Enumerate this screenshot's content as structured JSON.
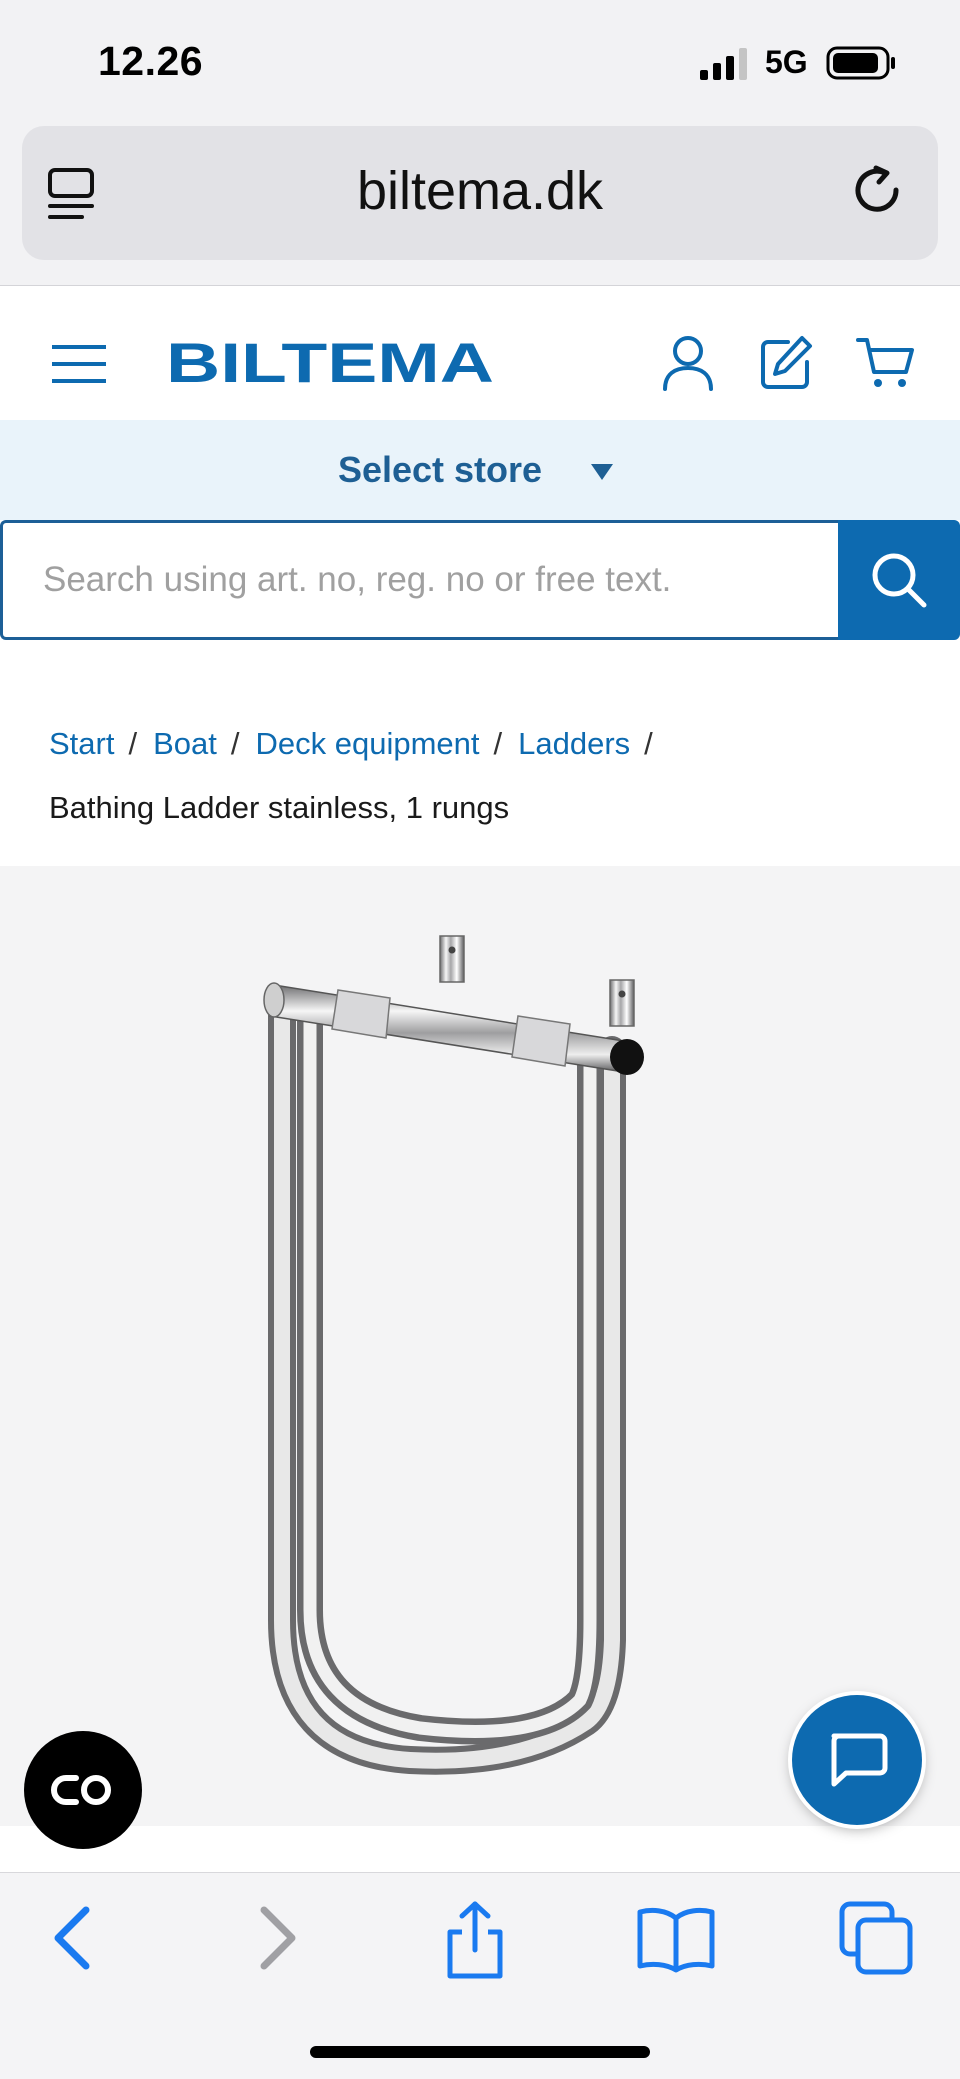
{
  "status_bar": {
    "time": "12.26",
    "network": "5G",
    "signal_icon": "signal-bars-icon",
    "battery_icon": "battery-icon"
  },
  "browser": {
    "url": "biltema.dk",
    "page_menu_icon": "page-menu-icon",
    "reload_icon": "reload-icon"
  },
  "header": {
    "logo_text": "BILTEMA",
    "brand_color": "#0d6ab0",
    "icons": [
      "hamburger-icon",
      "account-icon",
      "edit-icon",
      "cart-icon"
    ]
  },
  "store": {
    "label": "Select store"
  },
  "search": {
    "placeholder": "Search using art. no, reg. no or free text.",
    "value": ""
  },
  "breadcrumb": {
    "items": [
      "Start",
      "Boat",
      "Deck equipment",
      "Ladders"
    ],
    "separator": "/",
    "current": "Bathing Ladder stainless, 1 rungs"
  },
  "product": {
    "image_subject": "stainless bathing ladder"
  },
  "floating": {
    "accessibility_icon": "accessibility-icon",
    "chat_icon": "chat-icon"
  },
  "toolbar": {
    "icons": [
      "back-icon",
      "forward-icon",
      "share-icon",
      "bookmarks-icon",
      "tabs-icon"
    ]
  }
}
